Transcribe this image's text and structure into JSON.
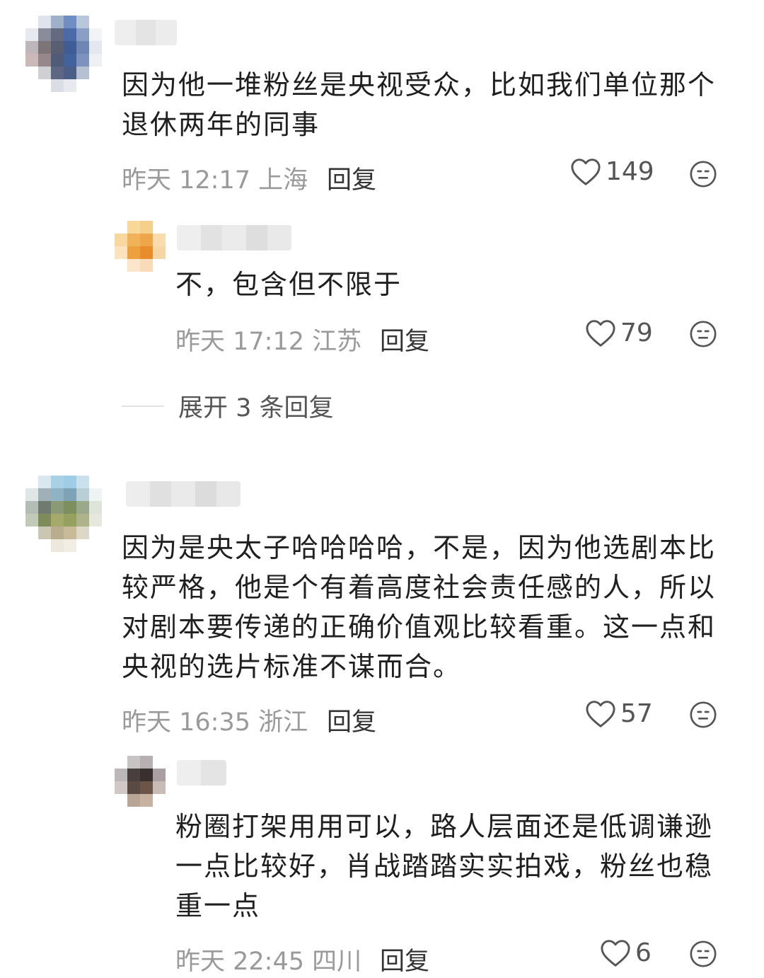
{
  "comments": [
    {
      "text": "因为他一堆粉丝是央视受众，比如我们单位那个退休两年的同事",
      "time": "昨天 12:17",
      "location": "上海",
      "reply_label": "回复",
      "likes": "149",
      "replies": [
        {
          "text": "不，包含但不限于",
          "time": "昨天 17:12",
          "location": "江苏",
          "reply_label": "回复",
          "likes": "79"
        }
      ],
      "expand_label": "展开 3 条回复"
    },
    {
      "text": "因为是央太子哈哈哈哈，不是，因为他选剧本比较严格，他是个有着高度社会责任感的人，所以对剧本要传递的正确价值观比较看重。这一点和央视的选片标准不谋而合。",
      "time": "昨天 16:35",
      "location": "浙江",
      "reply_label": "回复",
      "likes": "57",
      "replies": [
        {
          "text": "粉圈打架用用可以，路人层面还是低调谦逊一点比较好，肖战踏踏实实拍戏，粉丝也稳重一点",
          "time": "昨天 22:45",
          "location": "四川",
          "reply_label": "回复",
          "likes": "6"
        }
      ]
    }
  ],
  "icons": {
    "like": "heart-outline-icon",
    "reaction": "neutral-face-icon"
  },
  "colors": {
    "meta_gray": "#9a9a9a",
    "text": "#1f1f1f"
  }
}
